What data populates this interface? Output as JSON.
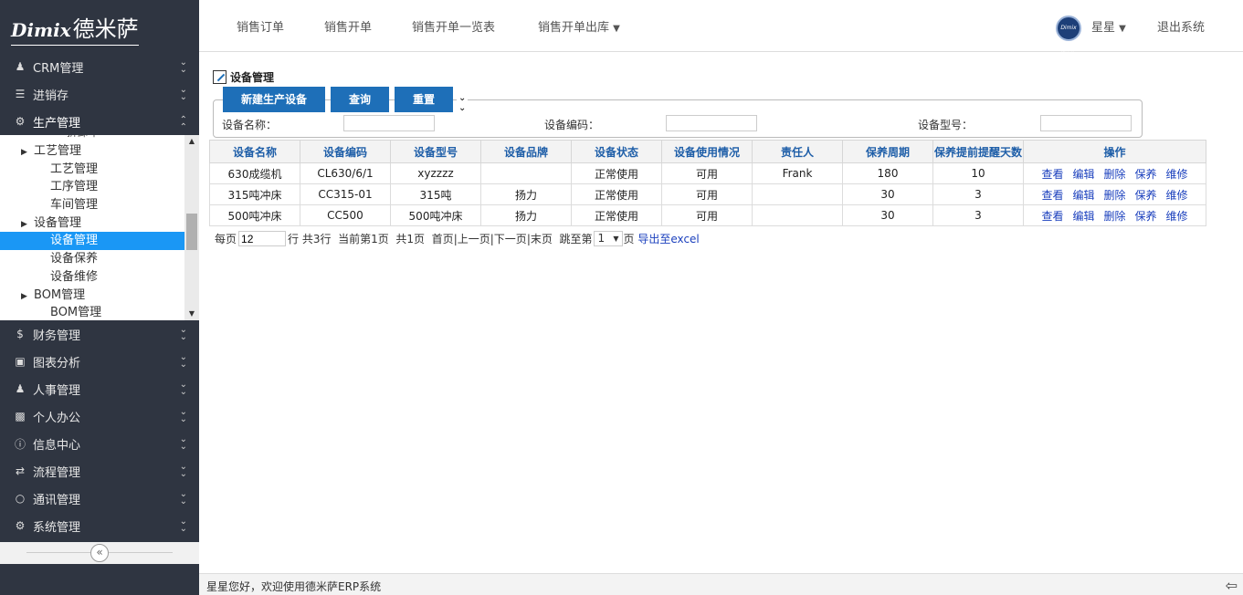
{
  "logo": {
    "brand_en": "Dimix",
    "brand_cn": "德米萨"
  },
  "topnav": {
    "links": [
      "销售订单",
      "销售开单",
      "销售开单一览表",
      "销售开单出库"
    ],
    "user_name": "星星",
    "logout": "退出系统",
    "avatar_text": "Dimix 德米萨"
  },
  "sidebar": {
    "menus_top": [
      {
        "label": "CRM管理",
        "icon": "user-icon"
      },
      {
        "label": "进销存",
        "icon": "list-icon"
      },
      {
        "label": "生产管理",
        "icon": "gears-icon"
      }
    ],
    "submenu": {
      "partial_item": "拆卸单",
      "items": [
        {
          "label": "工艺管理",
          "level": 1
        },
        {
          "label": "工艺管理",
          "level": 2
        },
        {
          "label": "工序管理",
          "level": 2
        },
        {
          "label": "车间管理",
          "level": 2
        },
        {
          "label": "设备管理",
          "level": 1
        },
        {
          "label": "设备管理",
          "level": 2,
          "active": true
        },
        {
          "label": "设备保养",
          "level": 2
        },
        {
          "label": "设备维修",
          "level": 2
        },
        {
          "label": "BOM管理",
          "level": 1
        },
        {
          "label": "BOM管理",
          "level": 2
        }
      ]
    },
    "menus_bottom": [
      {
        "label": "财务管理",
        "icon": "dollar-icon"
      },
      {
        "label": "图表分析",
        "icon": "picture-icon"
      },
      {
        "label": "人事管理",
        "icon": "people-icon"
      },
      {
        "label": "个人办公",
        "icon": "briefcase-icon"
      },
      {
        "label": "信息中心",
        "icon": "info-icon"
      },
      {
        "label": "流程管理",
        "icon": "transfer-icon"
      },
      {
        "label": "通讯管理",
        "icon": "chat-icon"
      },
      {
        "label": "系统管理",
        "icon": "gear-icon"
      }
    ]
  },
  "page": {
    "title": "设备管理",
    "buttons": {
      "new": "新建生产设备",
      "query": "查询",
      "reset": "重置"
    },
    "filters": [
      {
        "label": "设备名称：",
        "value": ""
      },
      {
        "label": "设备编码：",
        "value": ""
      },
      {
        "label": "设备型号：",
        "value": ""
      }
    ]
  },
  "table": {
    "headers": [
      "设备名称",
      "设备编码",
      "设备型号",
      "设备品牌",
      "设备状态",
      "设备使用情况",
      "责任人",
      "保养周期",
      "保养提前提醒天数",
      "操作"
    ],
    "rows": [
      [
        "630成缆机",
        "CL630/6/1",
        "xyzzzz",
        "",
        "正常使用",
        "可用",
        "Frank",
        "180",
        "10"
      ],
      [
        "315吨冲床",
        "CC315-01",
        "315吨",
        "扬力",
        "正常使用",
        "可用",
        "",
        "30",
        "3"
      ],
      [
        "500吨冲床",
        "CC500",
        "500吨冲床",
        "扬力",
        "正常使用",
        "可用",
        "",
        "30",
        "3"
      ]
    ],
    "actions": [
      "查看",
      "编辑",
      "删除",
      "保养",
      "维修"
    ]
  },
  "pager": {
    "per_page_prefix": "每页",
    "per_page_value": "12",
    "rows_text": "行 共3行",
    "current_page": "当前第1页",
    "total_pages": "共1页",
    "first": "首页",
    "prev": "上一页",
    "next": "下一页",
    "last": "末页",
    "jump_prefix": "跳至第",
    "jump_value": "1",
    "jump_suffix": "页",
    "export": "导出至excel"
  },
  "footer": {
    "text": "星星您好，欢迎使用德米萨ERP系统"
  }
}
